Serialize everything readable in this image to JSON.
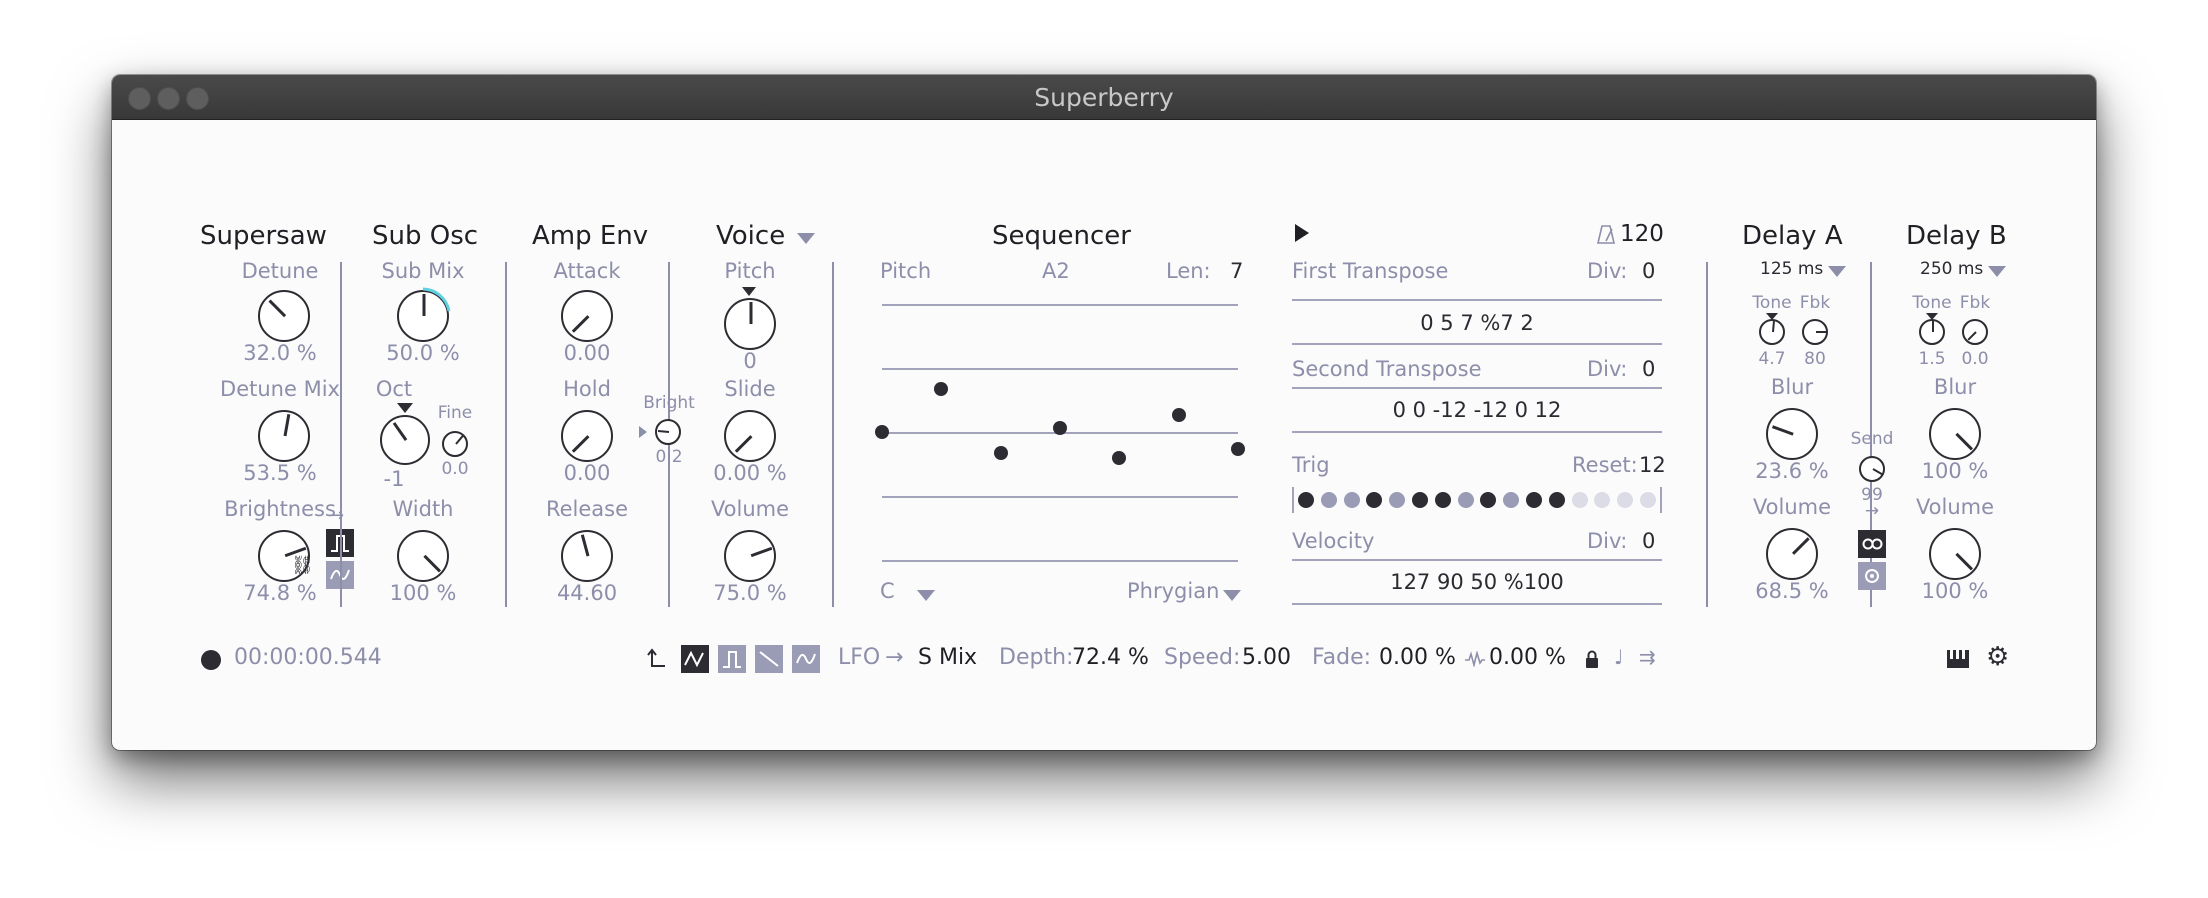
{
  "window": {
    "title": "Superberry"
  },
  "supersaw": {
    "title": "Supersaw",
    "detune_label": "Detune",
    "detune_value": "32.0 %",
    "detune_mix_label": "Detune Mix",
    "detune_mix_value": "53.5 %",
    "brightness_label": "Brightness",
    "brightness_value": "74.8 %",
    "arrow": "→"
  },
  "sub_osc": {
    "title": "Sub Osc",
    "sub_mix_label": "Sub Mix",
    "sub_mix_value": "50.0 %",
    "oct_label": "Oct",
    "oct_value": "-1",
    "fine_label": "Fine",
    "fine_value": "0.0",
    "width_label": "Width",
    "width_value": "100 %"
  },
  "amp_env": {
    "title": "Amp Env",
    "attack_label": "Attack",
    "attack_value": "0.00",
    "hold_label": "Hold",
    "hold_value": "0.00",
    "release_label": "Release",
    "release_value": "44.60",
    "bright_label": "Bright",
    "bright_value": "0.2"
  },
  "voice": {
    "title": "Voice",
    "pitch_label": "Pitch",
    "pitch_value": "0",
    "slide_label": "Slide",
    "slide_value": "0.00 %",
    "volume_label": "Volume",
    "volume_value": "75.0 %"
  },
  "sequencer": {
    "title": "Sequencer",
    "pitch_label": "Pitch",
    "note": "A2",
    "len_label": "Len:",
    "len_value": "7",
    "key": "C",
    "scale": "Phrygian",
    "steps": [
      0,
      1,
      -0.5,
      0.1,
      -0.6,
      0.4,
      -0.4
    ]
  },
  "transport": {
    "tempo": "120",
    "play_icon": "play-icon",
    "metronome_icon": "metronome-icon"
  },
  "patterns": {
    "first_transpose_label": "First Transpose",
    "first_div_label": "Div:",
    "first_div_value": "0",
    "first_sequence": "0 5 7 %7 2",
    "second_transpose_label": "Second Transpose",
    "second_div_label": "Div:",
    "second_div_value": "0",
    "second_sequence": "0 0 -12 -12 0 12",
    "trig_label": "Trig",
    "reset_label": "Reset:",
    "reset_value": "12",
    "trig_steps": [
      "on",
      "mid",
      "mid",
      "on",
      "mid",
      "on",
      "on",
      "mid",
      "on",
      "mid",
      "on",
      "on",
      "off",
      "off",
      "off",
      "off"
    ],
    "velocity_label": "Velocity",
    "velocity_div_label": "Div:",
    "velocity_div_value": "0",
    "velocity_sequence": "127 90 50 %100"
  },
  "delay_a": {
    "title": "Delay A",
    "time": "125 ms",
    "tone_label": "Tone",
    "tone_value": "4.7",
    "fbk_label": "Fbk",
    "fbk_value": "80",
    "blur_label": "Blur",
    "blur_value": "23.6 %",
    "volume_label": "Volume",
    "volume_value": "68.5 %"
  },
  "send": {
    "label": "Send",
    "value": "99",
    "arrow": "→"
  },
  "delay_b": {
    "title": "Delay B",
    "time": "250 ms",
    "tone_label": "Tone",
    "tone_value": "1.5",
    "fbk_label": "Fbk",
    "fbk_value": "0.0",
    "blur_label": "Blur",
    "blur_value": "100 %",
    "volume_label": "Volume",
    "volume_value": "100 %"
  },
  "footer": {
    "timecode": "00:00:00.544",
    "lfo_label": "LFO",
    "lfo_arrow": "→",
    "lfo_target": "S Mix",
    "depth_label": "Depth:",
    "depth_value": "72.4 %",
    "speed_label": "Speed:",
    "speed_value": "5.00",
    "fade_label": "Fade:",
    "fade_value": "0.00 %",
    "jitter_value": "0.00 %"
  },
  "colors": {
    "accent": "#8d8ea9",
    "text": "#1f1f24",
    "active": "#2c2c32",
    "arc": "#5fd0e0"
  }
}
